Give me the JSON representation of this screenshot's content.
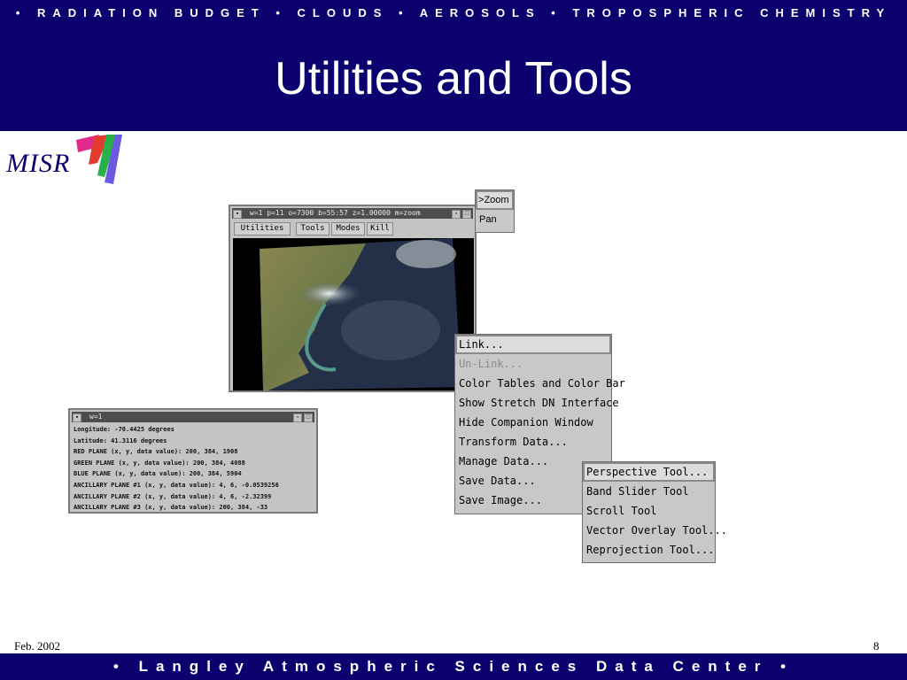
{
  "header": {
    "tagline": "• RADIATION BUDGET • CLOUDS • AEROSOLS • TROPOSPHERIC CHEMISTRY",
    "title": "Utilities and Tools"
  },
  "logo": {
    "text": "MISR"
  },
  "viewer": {
    "title": "w=1 p=11 o=7300 b=55:57 z=1.00000 m=zoom",
    "menu": [
      "Utilities",
      "Tools",
      "Modes",
      "Kill"
    ]
  },
  "mode_menu": {
    "items": [
      "Zoom",
      "Pan"
    ],
    "selected_prefix": ">"
  },
  "utilities_menu": {
    "items": [
      "Link...",
      "Un-Link...",
      "Color Tables and Color Bar",
      "Show Stretch DN Interface",
      "Hide Companion Window",
      "Transform Data...",
      "Manage Data...",
      "Save Data...",
      "Save Image..."
    ]
  },
  "tools_menu": {
    "items": [
      "Perspective Tool...",
      "Band Slider Tool",
      "Scroll Tool",
      "Vector Overlay Tool...",
      "Reprojection Tool..."
    ]
  },
  "info_window": {
    "title": "w=1",
    "lines": [
      "Longitude: -70.4425 degrees",
      "Latitude: 41.3116 degrees",
      "RED PLANE (x, y, data value): 200, 384, 1908",
      "GREEN PLANE (x, y, data value): 200, 384, 4088",
      "BLUE PLANE (x, y, data value): 200, 384, 5904",
      "ANCILLARY PLANE #1 (x, y, data value): 4, 6, -0.0539256",
      "ANCILLARY PLANE #2 (x, y, data value): 4, 6, -2.32399",
      "ANCILLARY PLANE #3 (x, y, data value): 200, 384, -33"
    ]
  },
  "footer": {
    "date": "Feb. 2002",
    "page": "8",
    "org": "• Langley Atmospheric Sciences Data Center •"
  },
  "colors": {
    "header_bg": "#0c006e",
    "window_bg": "#c4c4c4",
    "text_white": "#ffffff"
  }
}
